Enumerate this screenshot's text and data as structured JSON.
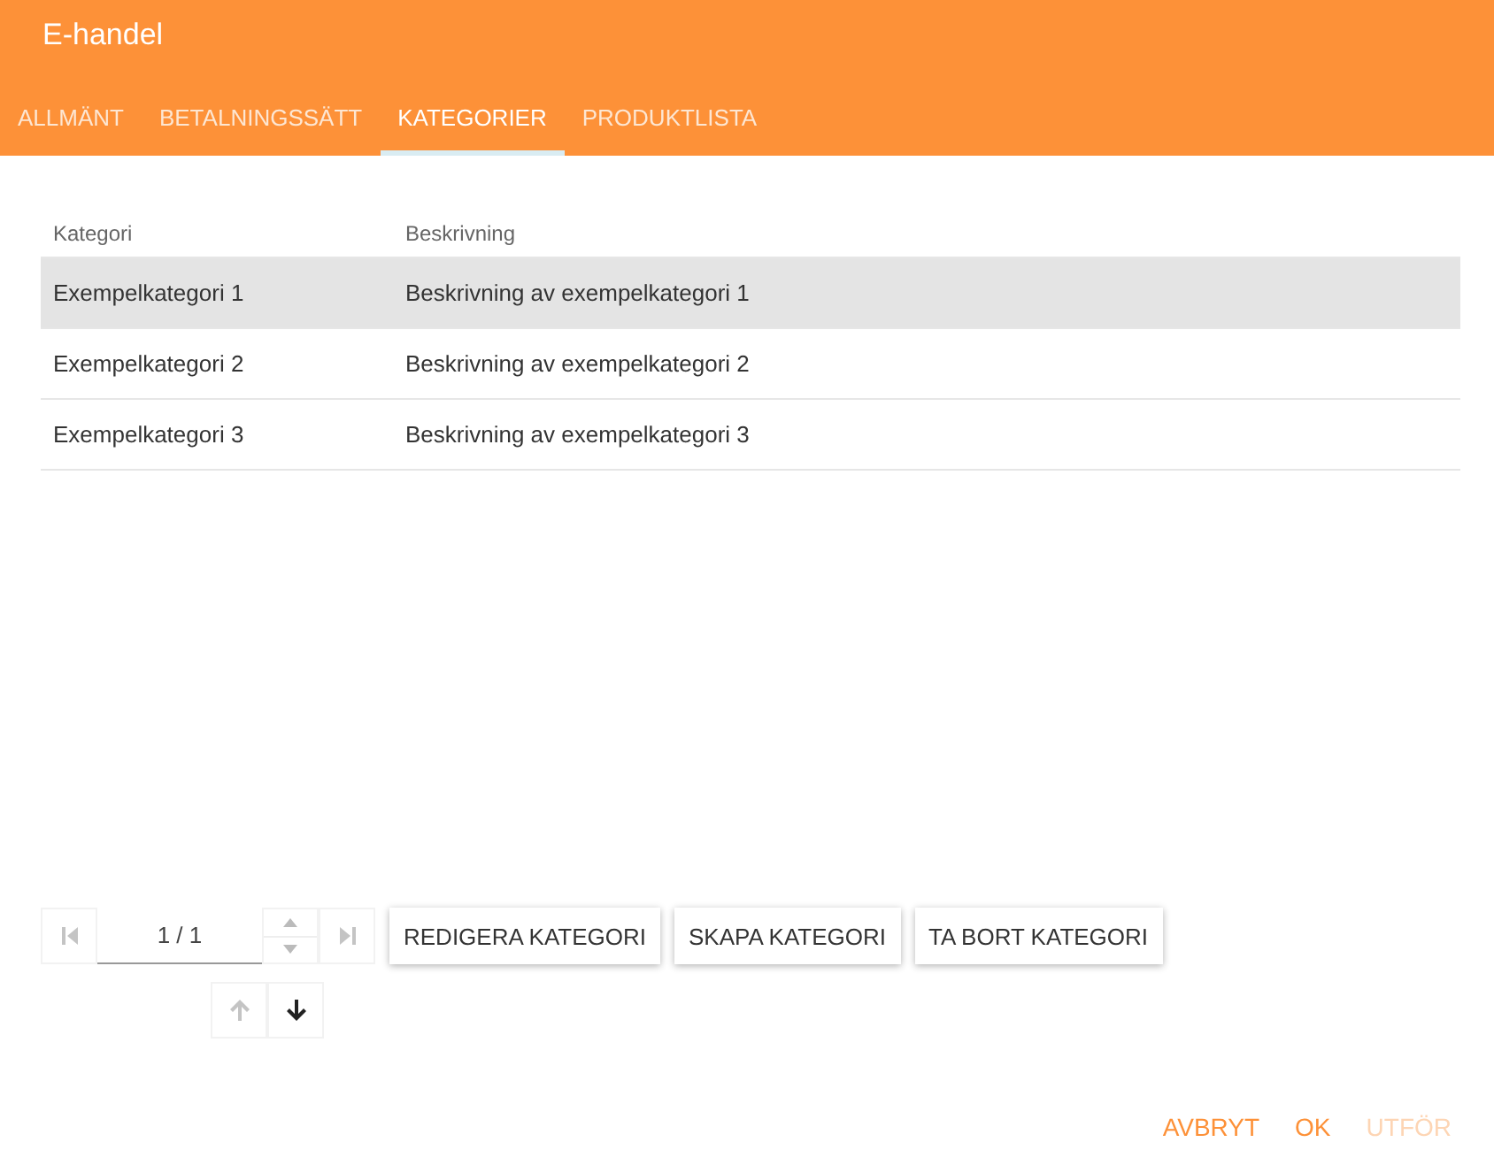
{
  "window": {
    "title": "E-handel"
  },
  "tabs": [
    {
      "label": "ALLMÄNT",
      "selected": false
    },
    {
      "label": "BETALNINGSSÄTT",
      "selected": false
    },
    {
      "label": "KATEGORIER",
      "selected": true
    },
    {
      "label": "PRODUKTLISTA",
      "selected": false
    }
  ],
  "table": {
    "columns": [
      "Kategori",
      "Beskrivning"
    ],
    "rows": [
      {
        "cells": [
          "Exempelkategori 1",
          "Beskrivning av exempelkategori 1"
        ],
        "selected": true
      },
      {
        "cells": [
          "Exempelkategori 2",
          "Beskrivning av exempelkategori 2"
        ],
        "selected": false
      },
      {
        "cells": [
          "Exempelkategori 3",
          "Beskrivning av exempelkategori 3"
        ],
        "selected": false
      }
    ]
  },
  "pager": {
    "page": "1 / 1",
    "first_disabled": true,
    "last_disabled": true,
    "spin_disabled": true
  },
  "actions": [
    "REDIGERA KATEGORI",
    "SKAPA KATEGORI",
    "TA BORT KATEGORI"
  ],
  "move": {
    "up_disabled": true,
    "down_disabled": false
  },
  "footer": [
    {
      "label": "AVBRYT",
      "disabled": false
    },
    {
      "label": "OK",
      "disabled": false
    },
    {
      "label": "UTFÖR",
      "disabled": true
    }
  ]
}
